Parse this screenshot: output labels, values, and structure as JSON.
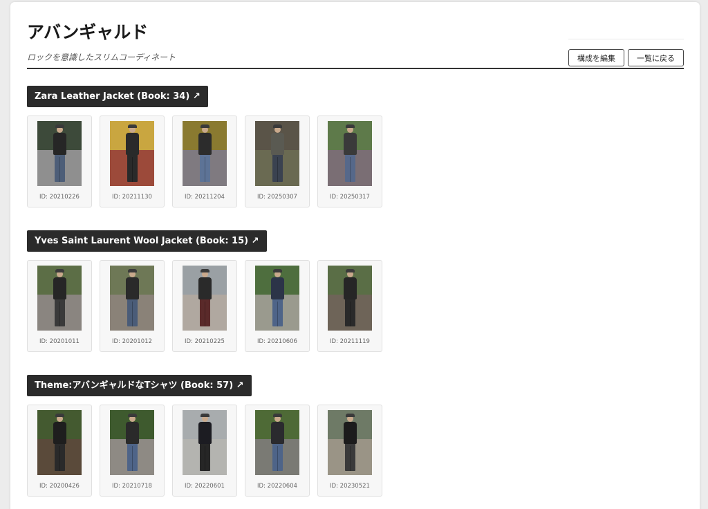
{
  "page": {
    "title": "アバンギャルド",
    "subtitle": "ロックを意識したスリムコーディネート",
    "edit_button": "構成を編集",
    "back_button": "一覧に戻る"
  },
  "sections": [
    {
      "title": "Zara Leather Jacket (Book: 34) ↗",
      "items": [
        {
          "id": "ID: 20210226",
          "sky": "#3d4a3a",
          "ground": "#8f8f8f",
          "top": "#262626",
          "bottom": "#4d5e78"
        },
        {
          "id": "ID: 20211130",
          "sky": "#c9a640",
          "ground": "#9c4a3a",
          "top": "#2a2a2a",
          "bottom": "#2a2a2a"
        },
        {
          "id": "ID: 20211204",
          "sky": "#8a7a30",
          "ground": "#7f7a80",
          "top": "#2c2c2c",
          "bottom": "#5d7396"
        },
        {
          "id": "ID: 20250307",
          "sky": "#5a5448",
          "ground": "#6a6a52",
          "top": "#5a5a52",
          "bottom": "#3a4250"
        },
        {
          "id": "ID: 20250317",
          "sky": "#5e7a4a",
          "ground": "#7a6e74",
          "top": "#3a3a3a",
          "bottom": "#56688a"
        }
      ]
    },
    {
      "title": "Yves Saint Laurent Wool Jacket (Book: 15) ↗",
      "items": [
        {
          "id": "ID: 20201011",
          "sky": "#5c6e46",
          "ground": "#8a8580",
          "top": "#262626",
          "bottom": "#3a3a3a"
        },
        {
          "id": "ID: 20201012",
          "sky": "#6e7856",
          "ground": "#8a8278",
          "top": "#2a2a2a",
          "bottom": "#4a5c78"
        },
        {
          "id": "ID: 20210225",
          "sky": "#9aa0a4",
          "ground": "#b0a8a0",
          "top": "#2a2a2a",
          "bottom": "#5a2a2a"
        },
        {
          "id": "ID: 20210606",
          "sky": "#4e6e3e",
          "ground": "#9a9a8e",
          "top": "#2c3448",
          "bottom": "#4e6488"
        },
        {
          "id": "ID: 20211119",
          "sky": "#5a6e46",
          "ground": "#6e6458",
          "top": "#262626",
          "bottom": "#2a2a2a"
        }
      ]
    },
    {
      "title": "Theme:アバンギャルドなTシャツ (Book: 57) ↗",
      "items": [
        {
          "id": "ID: 20200426",
          "sky": "#445a30",
          "ground": "#5a4a3a",
          "top": "#1e1e1e",
          "bottom": "#2a2a2a"
        },
        {
          "id": "ID: 20210718",
          "sky": "#3e5a2e",
          "ground": "#8e8a84",
          "top": "#2a2a2a",
          "bottom": "#4e6488"
        },
        {
          "id": "ID: 20220601",
          "sky": "#a8acae",
          "ground": "#b4b4b0",
          "top": "#1c1c22",
          "bottom": "#262626"
        },
        {
          "id": "ID: 20220604",
          "sky": "#4e6a36",
          "ground": "#7a7a74",
          "top": "#2a2a2e",
          "bottom": "#4e6488"
        },
        {
          "id": "ID: 20230521",
          "sky": "#6e7a66",
          "ground": "#9a9486",
          "top": "#1c1c1c",
          "bottom": "#3a3a3a"
        }
      ]
    }
  ]
}
